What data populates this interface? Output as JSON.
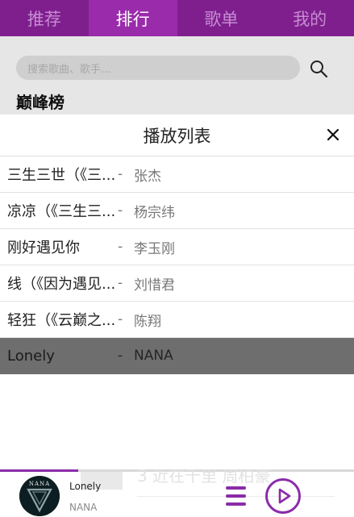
{
  "tabs": [
    {
      "label": "推荐"
    },
    {
      "label": "排行"
    },
    {
      "label": "歌单"
    },
    {
      "label": "我的"
    }
  ],
  "active_tab": "排行",
  "search": {
    "placeholder": "搜索歌曲、歌手..."
  },
  "section_title": "巅峰榜",
  "playlist": {
    "title": "播放列表",
    "close_icon": "close-icon",
    "separator": "-",
    "items": [
      {
        "song": "三生三世（《三生三世十里桃花》电视剧片头曲）",
        "artist": "张杰"
      },
      {
        "song": "凉凉（《三生三世十里桃花》电视剧片尾曲）",
        "artist": "杨宗纬"
      },
      {
        "song": "刚好遇见你",
        "artist": "李玉刚"
      },
      {
        "song": "线（《因为遇见你》电视剧主题曲）",
        "artist": "刘惜君"
      },
      {
        "song": "轻狂（《云巅之上》电视剧主题曲）",
        "artist": "陈翔"
      },
      {
        "song": "Lonely",
        "artist": "NANA",
        "playing": true
      }
    ]
  },
  "background_list": {
    "partial_item": "3 近在千里 周柏豪"
  },
  "player": {
    "disc_label": "NANA",
    "song": "Lonely",
    "artist": "NANA",
    "progress": 0.22,
    "icons": [
      "menu-icon",
      "play-icon"
    ]
  },
  "colors": {
    "tab_bar": "#7f1f8e",
    "tab_active": "#9a2bab",
    "accent": "#8a2ca8",
    "playing_row": "#6e6e6e"
  }
}
